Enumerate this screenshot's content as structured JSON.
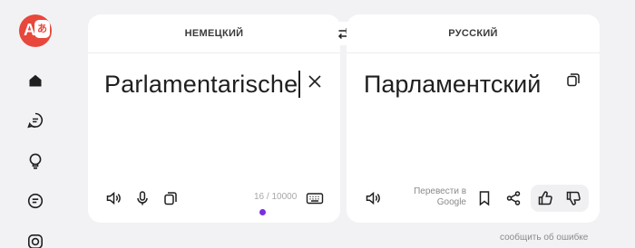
{
  "app": {
    "logo_glyph_latin": "A",
    "logo_glyph_native": "あ",
    "brand_color": "#e8473c"
  },
  "sidebar": {
    "items": [
      {
        "icon": "home-icon"
      },
      {
        "icon": "chat-translate-icon"
      },
      {
        "icon": "lightbulb-icon"
      },
      {
        "icon": "message-icon"
      },
      {
        "icon": "camera-icon"
      }
    ]
  },
  "source": {
    "language": "НЕМЕЦКИЙ",
    "text": "Parlamentarische",
    "counter": "16 / 10000"
  },
  "target": {
    "language": "РУССКИЙ",
    "text": "Парламентский",
    "google_link": "Перевести в Google"
  },
  "footer": {
    "report_label": "сообщить об ошибке"
  },
  "colors": {
    "accent_dot": "#7b2ee0"
  }
}
